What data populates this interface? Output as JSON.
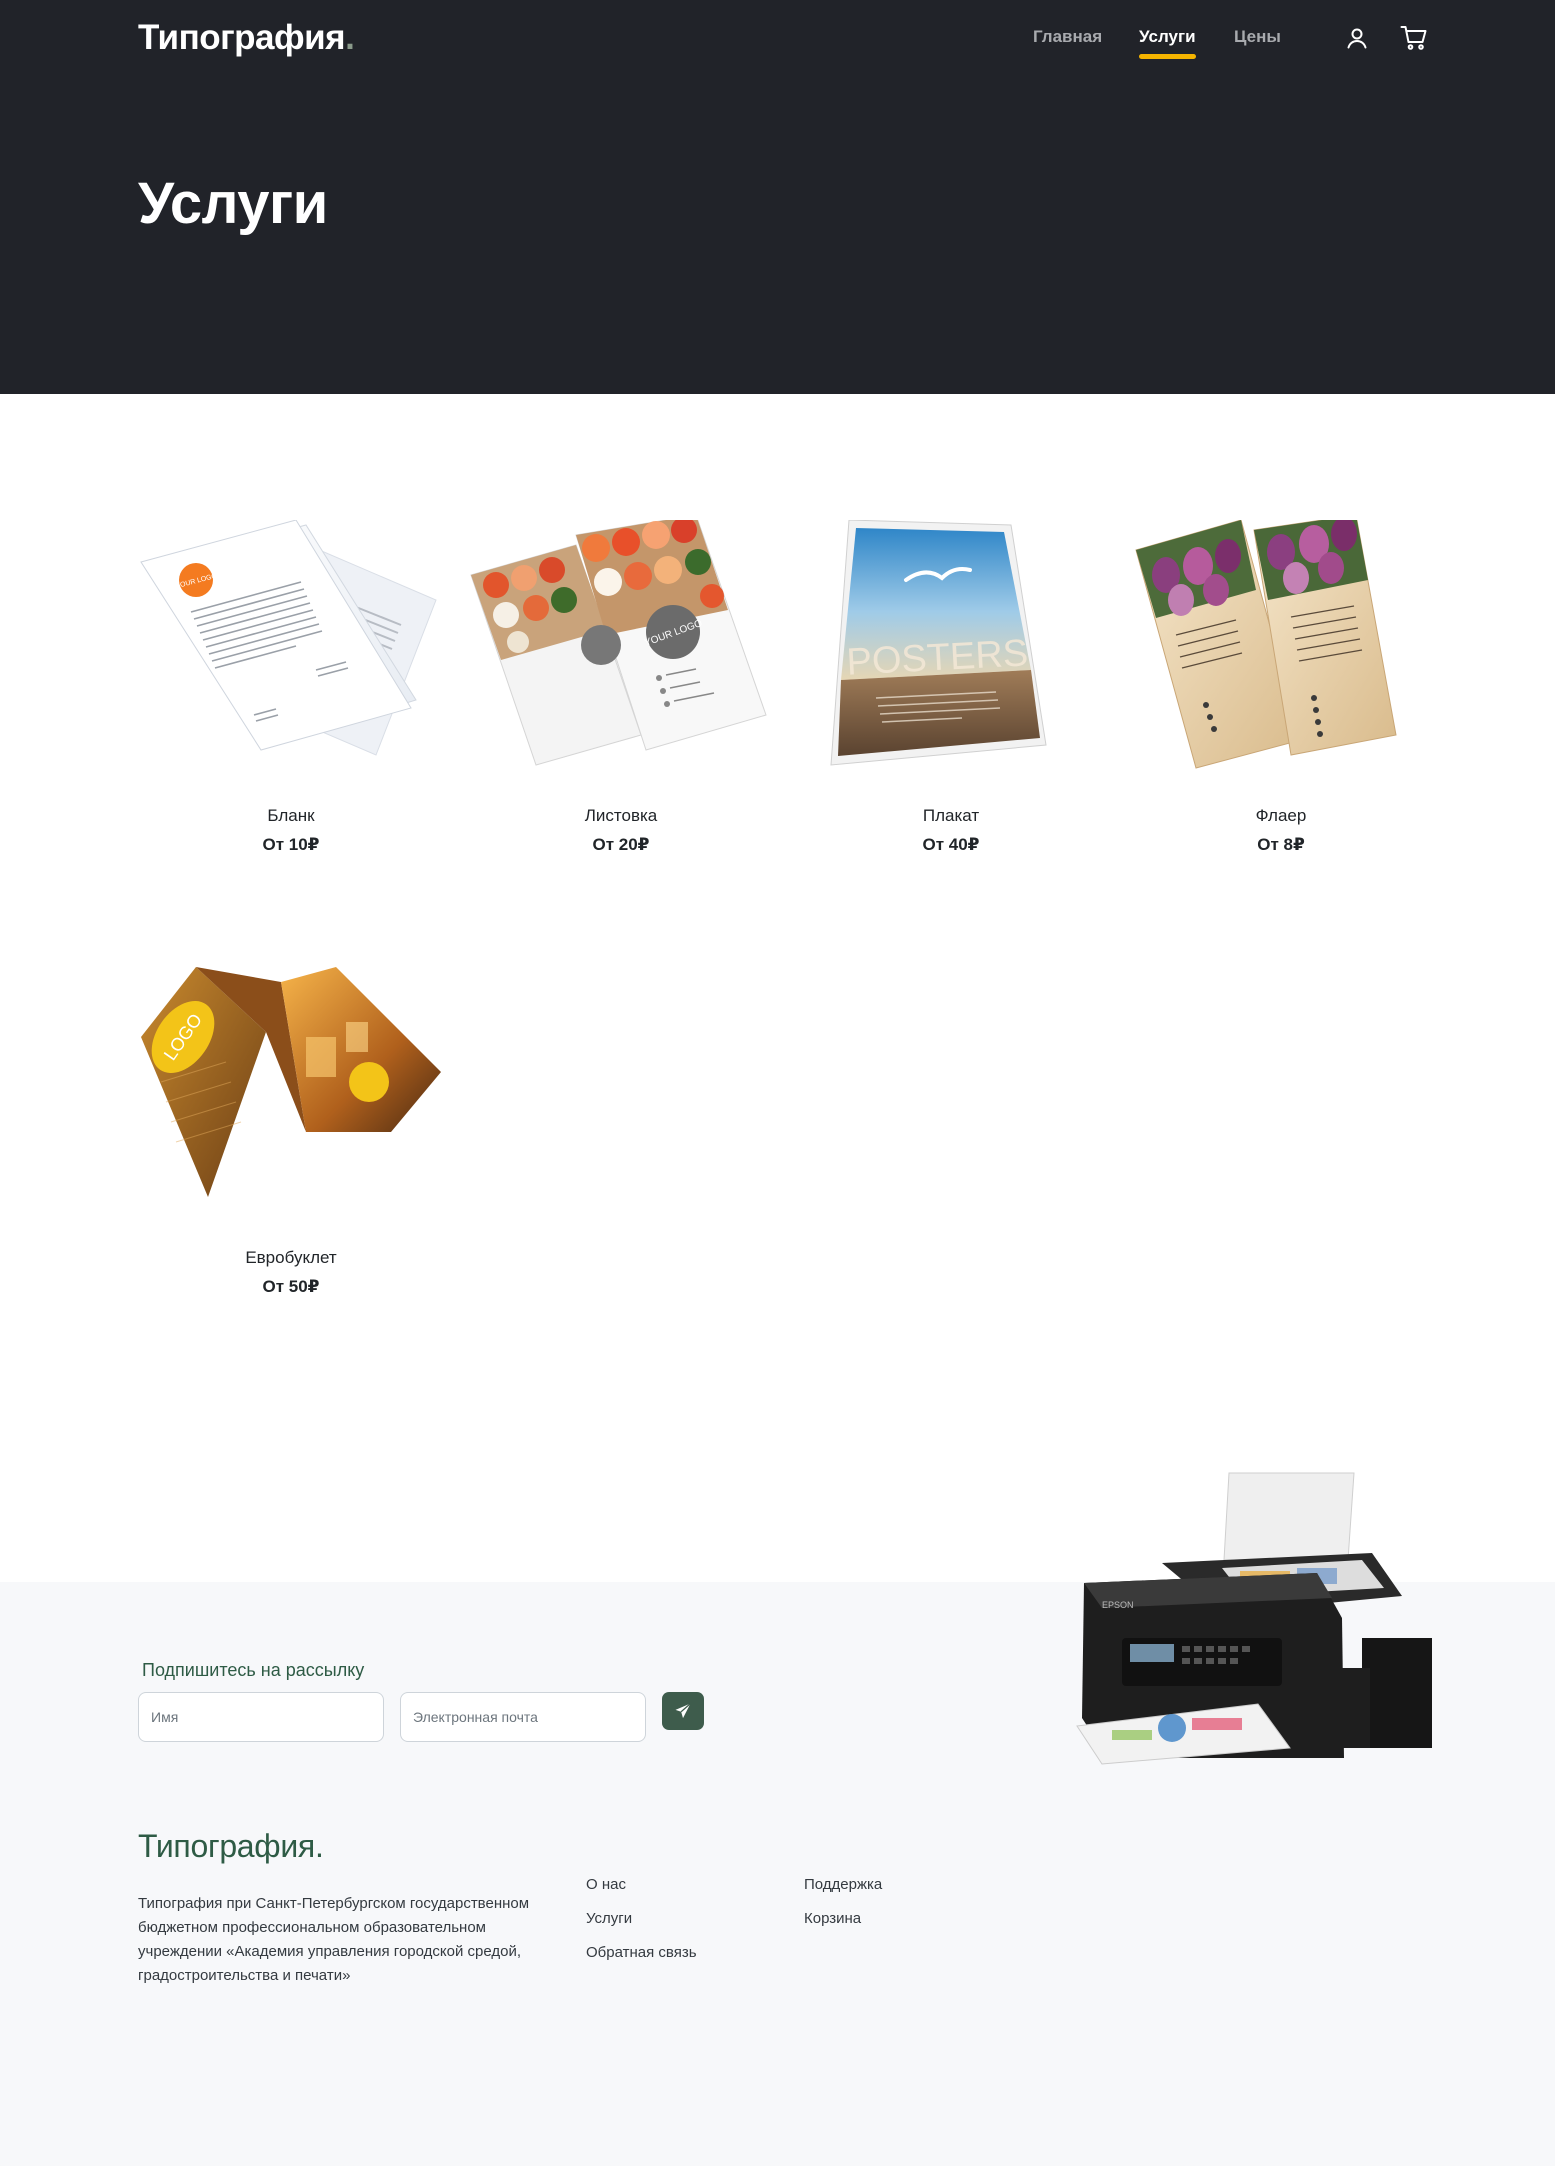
{
  "header": {
    "logo": "Типография",
    "logo_dot": ".",
    "nav": [
      {
        "label": "Главная",
        "active": false
      },
      {
        "label": "Услуги",
        "active": true
      },
      {
        "label": "Цены",
        "active": false
      }
    ],
    "icons": [
      "user-icon",
      "cart-icon"
    ],
    "accent_color": "#f5b400",
    "background_color": "#212329"
  },
  "hero": {
    "title": "Услуги"
  },
  "products": [
    {
      "name": "Бланк",
      "price": "От 10₽"
    },
    {
      "name": "Листовка",
      "price": "От 20₽"
    },
    {
      "name": "Плакат",
      "price": "От 40₽"
    },
    {
      "name": "Флаер",
      "price": "От 8₽"
    },
    {
      "name": "Евробуклет",
      "price": "От 50₽"
    }
  ],
  "product_art": {
    "blank_logo": "YOUR LOGO",
    "leaflet_logo": "YOUR LOGO",
    "poster_text": "POSTERS",
    "booklet_logo": "LOGO",
    "printer_brand": "EPSON"
  },
  "subscribe": {
    "title": "Подпишитесь на рассылку",
    "name_placeholder": "Имя",
    "email_placeholder": "Электронная почта",
    "name_value": "",
    "email_value": "",
    "send_icon": "paper-plane-icon",
    "button_color": "#3e5c4c"
  },
  "footer": {
    "logo": "Типография.",
    "about": "Типография при Санкт-Петербургском государственном бюджетном профессиональном образовательном учреждении «Академия управления городской средой, градостроительства и печати»",
    "links_col1": [
      "О нас",
      "Услуги",
      "Обратная связь"
    ],
    "links_col2": [
      "Поддержка",
      "Корзина"
    ],
    "background_color": "#f7f8fa",
    "brand_color": "#2e5b45"
  }
}
